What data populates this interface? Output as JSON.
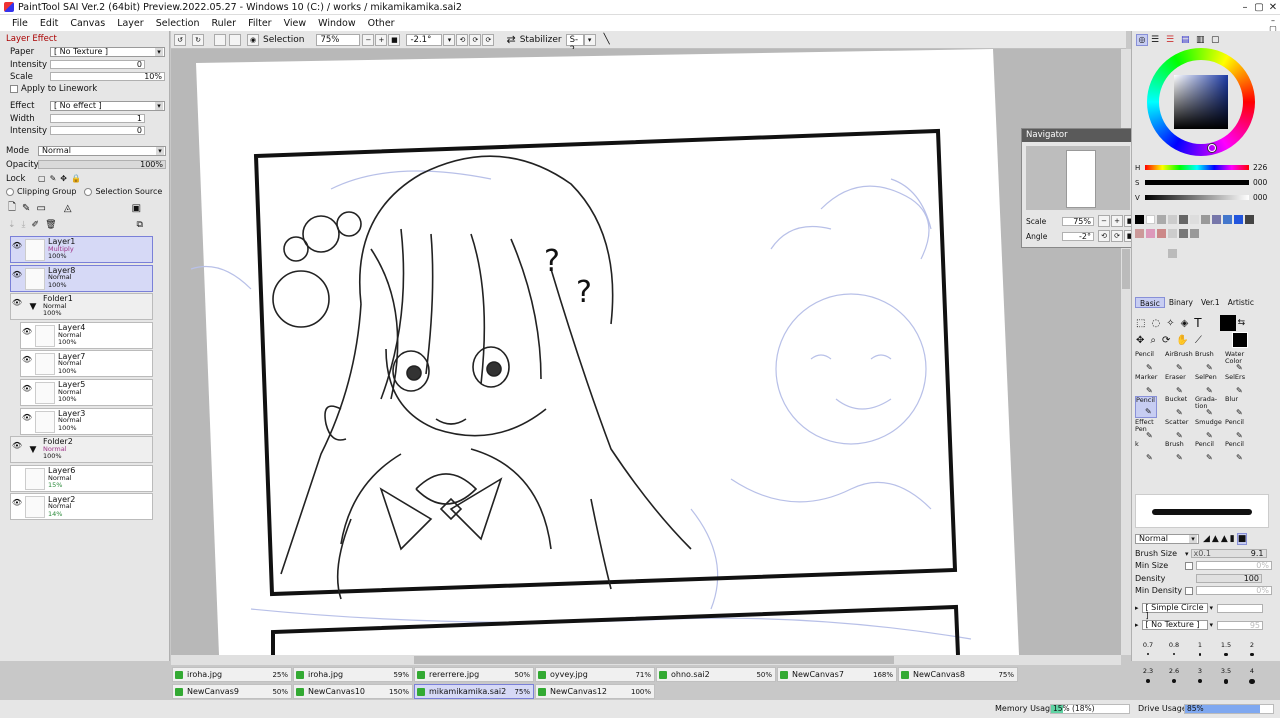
{
  "window": {
    "title": "PaintTool SAI Ver.2 (64bit) Preview.2022.05.27 - Windows 10 (C:) / works / mikamikamika.sai2"
  },
  "menu": [
    "File",
    "Edit",
    "Canvas",
    "Layer",
    "Selection",
    "Ruler",
    "Filter",
    "View",
    "Window",
    "Other"
  ],
  "layer_effect": {
    "title": "Layer Effect",
    "paper_label": "Paper",
    "paper_value": "[ No Texture ]",
    "intensity_label": "Intensity",
    "intensity_value": "0",
    "scale_label": "Scale",
    "scale_value": "10%",
    "apply_linework": "Apply to Linework",
    "effect_label": "Effect",
    "effect_value": "[ No effect ]",
    "width_label": "Width",
    "width_value": "1",
    "intensity2_label": "Intensity",
    "intensity2_value": "0"
  },
  "layer_props": {
    "mode_label": "Mode",
    "mode_value": "Normal",
    "opacity_label": "Opacity",
    "opacity_value": "100%",
    "lock_label": "Lock",
    "clipping_group": "Clipping Group",
    "selection_source": "Selection Source"
  },
  "layers": [
    {
      "name": "Layer1",
      "mode": "Multiply",
      "opacity": "100%",
      "selected": true,
      "folder": false,
      "indent": false,
      "visible": true
    },
    {
      "name": "Layer8",
      "mode": "Normal",
      "opacity": "100%",
      "selected": true,
      "folder": false,
      "indent": false,
      "visible": true
    },
    {
      "name": "Folder1",
      "mode": "Normal",
      "opacity": "100%",
      "selected": false,
      "folder": true,
      "indent": false,
      "visible": true
    },
    {
      "name": "Layer4",
      "mode": "Normal",
      "opacity": "100%",
      "selected": false,
      "folder": false,
      "indent": true,
      "visible": true
    },
    {
      "name": "Layer7",
      "mode": "Normal",
      "opacity": "100%",
      "selected": false,
      "folder": false,
      "indent": true,
      "visible": true
    },
    {
      "name": "Layer5",
      "mode": "Normal",
      "opacity": "100%",
      "selected": false,
      "folder": false,
      "indent": true,
      "visible": true
    },
    {
      "name": "Layer3",
      "mode": "Normal",
      "opacity": "100%",
      "selected": false,
      "folder": false,
      "indent": true,
      "visible": true
    },
    {
      "name": "Folder2",
      "mode": "Normal",
      "opacity": "100%",
      "selected": false,
      "folder": true,
      "indent": false,
      "visible": true
    },
    {
      "name": "Layer6",
      "mode": "Normal",
      "opacity": "15%",
      "selected": false,
      "folder": false,
      "indent": false,
      "visible": false
    },
    {
      "name": "Layer2",
      "mode": "Normal",
      "opacity": "14%",
      "selected": false,
      "folder": false,
      "indent": false,
      "visible": true
    }
  ],
  "toolbar": {
    "selection_label": "Selection",
    "zoom": "75%",
    "angle": "-2.1°",
    "stabilizer_label": "Stabilizer",
    "stabilizer_value": "S-2"
  },
  "canvas": {
    "question1": "?",
    "question2": "?"
  },
  "navigator": {
    "title": "Navigator",
    "scale_label": "Scale",
    "scale_value": "75%",
    "angle_label": "Angle",
    "angle_value": "-2°"
  },
  "color": {
    "h_label": "H",
    "h_value": "226",
    "s_label": "S",
    "s_value": "000",
    "v_label": "V",
    "v_value": "000",
    "current_hue_color": "#1c3aa6"
  },
  "tool_tabs": [
    "Basic",
    "Binary",
    "Ver.1",
    "Artistic"
  ],
  "tools": [
    {
      "name": "Pencil",
      "sel": false
    },
    {
      "name": "AirBrush",
      "sel": false
    },
    {
      "name": "Brush",
      "sel": false
    },
    {
      "name": "Water Color",
      "sel": false
    },
    {
      "name": "Marker",
      "sel": false
    },
    {
      "name": "Eraser",
      "sel": false
    },
    {
      "name": "SelPen",
      "sel": false
    },
    {
      "name": "SelErs",
      "sel": false
    },
    {
      "name": "Pencil",
      "sel": true
    },
    {
      "name": "Bucket",
      "sel": false
    },
    {
      "name": "Grada- tion",
      "sel": false
    },
    {
      "name": "Blur",
      "sel": false
    },
    {
      "name": "Effect Pen",
      "sel": false
    },
    {
      "name": "Scatter",
      "sel": false
    },
    {
      "name": "Smudge",
      "sel": false
    },
    {
      "name": "Pencil",
      "sel": false
    },
    {
      "name": "k",
      "sel": false
    },
    {
      "name": "Brush",
      "sel": false
    },
    {
      "name": "Pencil",
      "sel": false
    },
    {
      "name": "Pencil",
      "sel": false
    }
  ],
  "brush": {
    "mode_value": "Normal",
    "size_label": "Brush Size",
    "size_mult": "x0.1",
    "size_value": "9.1",
    "min_size_label": "Min Size",
    "min_size_value": "0%",
    "density_label": "Density",
    "density_value": "100",
    "min_density_label": "Min Density",
    "min_density_value": "0%",
    "shape_value": "[ Simple Circle ]",
    "texture_value": "[ No Texture ]",
    "texture_strength": "95"
  },
  "brush_sizes": [
    "0.7",
    "0.8",
    "1",
    "1.5",
    "2",
    "2.3",
    "2.6",
    "3",
    "3.5",
    "4"
  ],
  "documents": [
    {
      "name": "iroha.jpg",
      "zoom": "25%",
      "active": false
    },
    {
      "name": "iroha.jpg",
      "zoom": "59%",
      "active": false
    },
    {
      "name": "rererrere.jpg",
      "zoom": "50%",
      "active": false
    },
    {
      "name": "oyvey.jpg",
      "zoom": "71%",
      "active": false
    },
    {
      "name": "ohno.sai2",
      "zoom": "50%",
      "active": false
    },
    {
      "name": "NewCanvas7",
      "zoom": "168%",
      "active": false
    },
    {
      "name": "NewCanvas8",
      "zoom": "75%",
      "active": false
    },
    {
      "name": "NewCanvas9",
      "zoom": "50%",
      "active": false
    },
    {
      "name": "NewCanvas10",
      "zoom": "150%",
      "active": false
    },
    {
      "name": "mikamikamika.sai2",
      "zoom": "75%",
      "active": true
    },
    {
      "name": "NewCanvas12",
      "zoom": "100%",
      "active": false
    }
  ],
  "status": {
    "memory_label": "Memory Usage",
    "memory_value": "15% (18%)",
    "memory_fraction": 0.15,
    "drive_label": "Drive Usage",
    "drive_value": "85%",
    "drive_fraction": 0.85
  }
}
